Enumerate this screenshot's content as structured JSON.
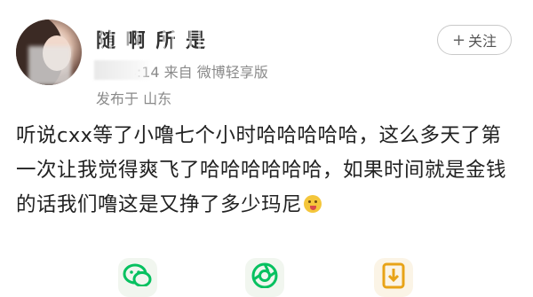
{
  "post": {
    "username": "随 啊 所 是 ",
    "meta": "12 14:14  来自 微博轻享版",
    "location": "发布于 山东",
    "follow_label": "关注",
    "follow_plus": "+",
    "content": "听说cxx等了小噜七个小时哈哈哈哈哈，这么多天了第一次让我觉得爽飞了哈哈哈哈哈哈，如果时间就是金钱的话我们噜这是又挣了多少玛尼"
  },
  "icons": {
    "avatar": "avatar-photo",
    "emoji": "tongue-out-emoji",
    "share_wechat": "wechat-icon",
    "share_moments": "moments-icon",
    "save_image": "save-image-icon"
  },
  "colors": {
    "accent_green": "#07c160",
    "save_orange": "#e8a317",
    "text_gray": "#8a8a8a"
  }
}
